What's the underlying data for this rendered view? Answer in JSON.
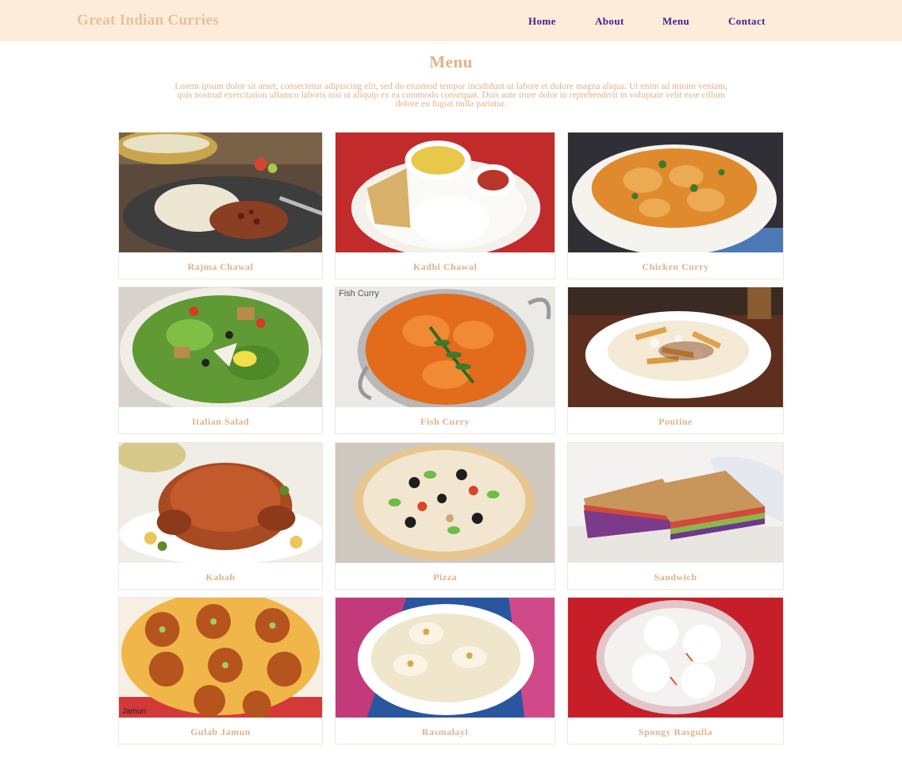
{
  "site": {
    "brand": "Great Indian Curries"
  },
  "nav": {
    "home": "Home",
    "about": "About",
    "menu": "Menu",
    "contact": "Contact"
  },
  "page": {
    "title": "Menu",
    "intro_line1": "Lorem ipsum dolor sit amet, consectetur adipiscing elit, sed do eiusmod tempor incididunt ut labore et dolore magna aliqua. Ut enim ad minim veniam,",
    "intro_line2": "quis nostrud exercitation ullamco laboris nisi ut aliquip ex ea commodo consequat. Duis aute irure dolor in reprehenderit in voluptate velit esse cillum",
    "intro_line3": "dolore eu fugiat nulla pariatur."
  },
  "menu_items": [
    {
      "name": "Rajma Chawal"
    },
    {
      "name": "Kadhi Chawal"
    },
    {
      "name": "Chicken Curry"
    },
    {
      "name": "Italian Salad"
    },
    {
      "name": "Fish Curry",
      "photo_caption": "Fish Curry"
    },
    {
      "name": "Poutine"
    },
    {
      "name": "Kabab"
    },
    {
      "name": "Pizza"
    },
    {
      "name": "Sandwich"
    },
    {
      "name": "Gulab Jamun",
      "photo_caption": "Jamun"
    },
    {
      "name": "Rasmalayi"
    },
    {
      "name": "Spongy Rasgulla"
    }
  ],
  "colors": {
    "navbar_bg": "#fcecd9",
    "brand_text": "#e7c19b",
    "nav_link": "#4a1a8a",
    "accent_text": "#e0b28a"
  }
}
